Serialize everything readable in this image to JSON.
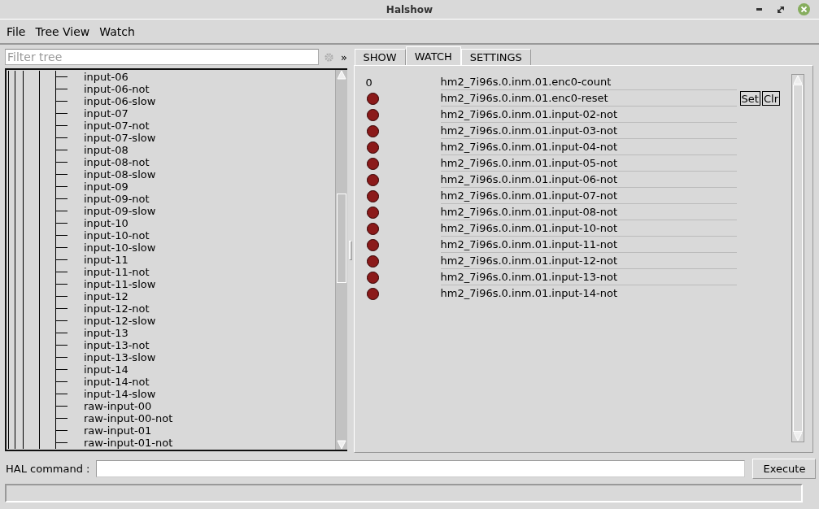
{
  "window": {
    "title": "Halshow"
  },
  "menu": [
    "File",
    "Tree View",
    "Watch"
  ],
  "filter": {
    "placeholder": "Filter tree"
  },
  "expand_label": "»",
  "tree": [
    "input-06",
    "input-06-not",
    "input-06-slow",
    "input-07",
    "input-07-not",
    "input-07-slow",
    "input-08",
    "input-08-not",
    "input-08-slow",
    "input-09",
    "input-09-not",
    "input-09-slow",
    "input-10",
    "input-10-not",
    "input-10-slow",
    "input-11",
    "input-11-not",
    "input-11-slow",
    "input-12",
    "input-12-not",
    "input-12-slow",
    "input-13",
    "input-13-not",
    "input-13-slow",
    "input-14",
    "input-14-not",
    "input-14-slow",
    "raw-input-00",
    "raw-input-00-not",
    "raw-input-01",
    "raw-input-01-not"
  ],
  "tabs": [
    {
      "label": "SHOW",
      "selected": false
    },
    {
      "label": "WATCH",
      "selected": true
    },
    {
      "label": "SETTINGS",
      "selected": false
    }
  ],
  "watch": [
    {
      "kind": "value",
      "value": "0",
      "name": "hm2_7i96s.0.inm.01.enc0-count"
    },
    {
      "kind": "bit",
      "on": false,
      "name": "hm2_7i96s.0.inm.01.enc0-reset",
      "buttons": [
        "Set",
        "Clr"
      ]
    },
    {
      "kind": "bit",
      "on": false,
      "name": "hm2_7i96s.0.inm.01.input-02-not"
    },
    {
      "kind": "bit",
      "on": false,
      "name": "hm2_7i96s.0.inm.01.input-03-not"
    },
    {
      "kind": "bit",
      "on": false,
      "name": "hm2_7i96s.0.inm.01.input-04-not"
    },
    {
      "kind": "bit",
      "on": false,
      "name": "hm2_7i96s.0.inm.01.input-05-not"
    },
    {
      "kind": "bit",
      "on": false,
      "name": "hm2_7i96s.0.inm.01.input-06-not"
    },
    {
      "kind": "bit",
      "on": false,
      "name": "hm2_7i96s.0.inm.01.input-07-not"
    },
    {
      "kind": "bit",
      "on": false,
      "name": "hm2_7i96s.0.inm.01.input-08-not"
    },
    {
      "kind": "bit",
      "on": false,
      "name": "hm2_7i96s.0.inm.01.input-10-not"
    },
    {
      "kind": "bit",
      "on": false,
      "name": "hm2_7i96s.0.inm.01.input-11-not"
    },
    {
      "kind": "bit",
      "on": false,
      "name": "hm2_7i96s.0.inm.01.input-12-not"
    },
    {
      "kind": "bit",
      "on": false,
      "name": "hm2_7i96s.0.inm.01.input-13-not"
    },
    {
      "kind": "bit",
      "on": false,
      "name": "hm2_7i96s.0.inm.01.input-14-not"
    }
  ],
  "command": {
    "label": "HAL command :",
    "button": "Execute"
  }
}
